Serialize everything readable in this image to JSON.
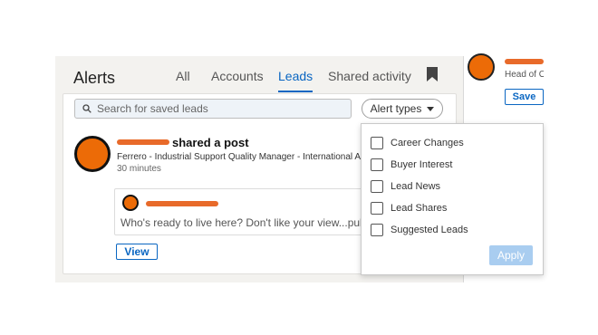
{
  "header": {
    "title": "Alerts",
    "tabs": [
      {
        "label": "All"
      },
      {
        "label": "Accounts"
      },
      {
        "label": "Leads"
      },
      {
        "label": "Shared activity"
      }
    ],
    "active_tab": "Leads"
  },
  "search": {
    "placeholder": "Search for saved leads"
  },
  "filter": {
    "label": "Alert types"
  },
  "post": {
    "action_text": "shared a post",
    "subtitle": "Ferrero - Industrial Support Quality Manager - International Area",
    "time": "30 minutes",
    "shared_text": "Who's ready to live here? Don't like your view...pull up an",
    "view_label": "View"
  },
  "right_panel": {
    "headline": "Head of Or",
    "save_label": "Save"
  },
  "dropdown": {
    "options": [
      {
        "label": "Career Changes"
      },
      {
        "label": "Buyer Interest"
      },
      {
        "label": "Lead News"
      },
      {
        "label": "Lead Shares"
      },
      {
        "label": "Suggested Leads"
      }
    ],
    "apply_label": "Apply"
  },
  "colors": {
    "accent": "#0a66c2",
    "avatar": "#ec6b07",
    "redaction": "#e86a2a",
    "apply_disabled": "#a9cdf0"
  }
}
